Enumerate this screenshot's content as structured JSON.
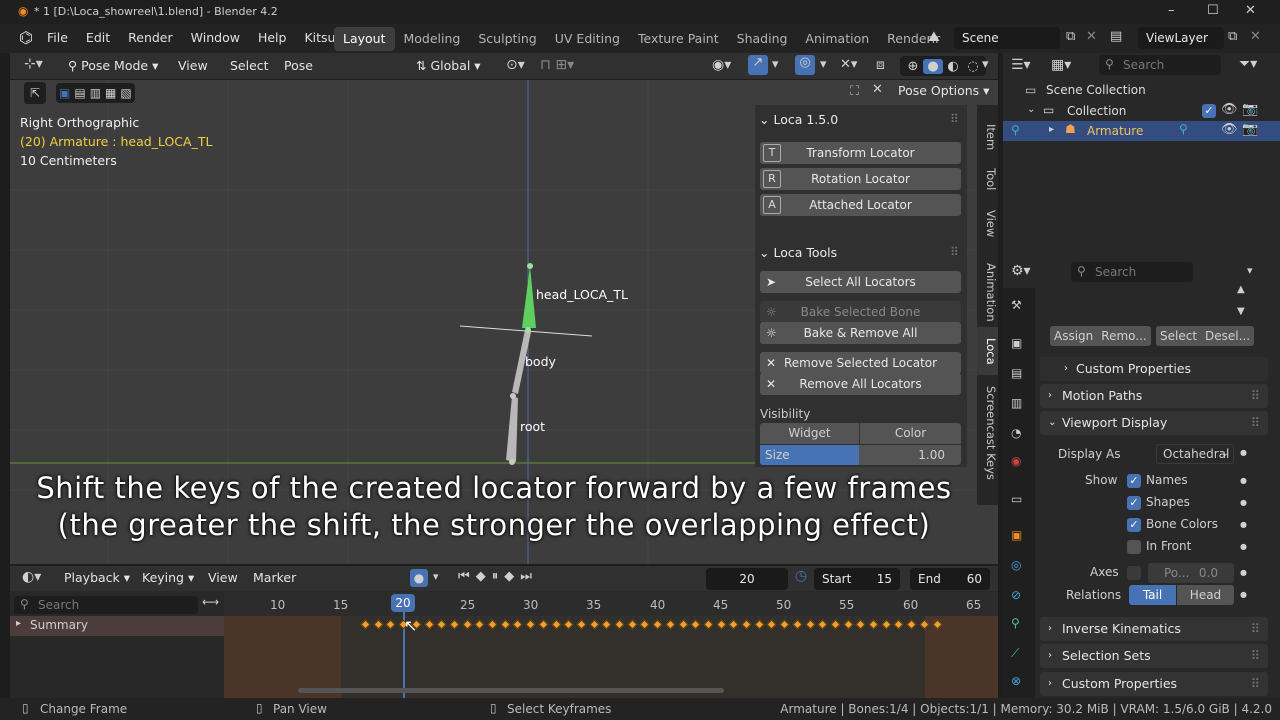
{
  "window": {
    "title": "* 1 [D:\\Loca_showreel\\1.blend] - Blender 4.2",
    "min": "–",
    "max": "☐",
    "close": "✕"
  },
  "menu": [
    "File",
    "Edit",
    "Render",
    "Window",
    "Help",
    "Kitsu"
  ],
  "workspaces": [
    "Layout",
    "Modeling",
    "Sculpting",
    "UV Editing",
    "Texture Paint",
    "Shading",
    "Animation",
    "Renderir"
  ],
  "scene": "Scene",
  "viewlayer": "ViewLayer",
  "viewport": {
    "mode": "Pose Mode",
    "menus": [
      "View",
      "Select",
      "Pose"
    ],
    "orientation": "Global",
    "view_name": "Right Orthographic",
    "object_info": "(20) Armature : head_LOCA_TL",
    "scale": "10 Centimeters",
    "pose_options": "Pose Options",
    "bones": {
      "head": "head_LOCA_TL",
      "body": "body",
      "root": "root"
    }
  },
  "npanel": {
    "loca_header": "Loca 1.5.0",
    "buttons1": [
      {
        "icon": "T",
        "label": "Transform Locator"
      },
      {
        "icon": "R",
        "label": "Rotation Locator"
      },
      {
        "icon": "A",
        "label": "Attached Locator"
      }
    ],
    "tools_header": "Loca Tools",
    "select_all": "Select All Locators",
    "bake_selected": "Bake Selected Bone",
    "bake_remove": "Bake & Remove All",
    "remove_selected": "Remove Selected Locator",
    "remove_all": "Remove All Locators",
    "visibility": "Visibility",
    "widget": "Widget",
    "color": "Color",
    "size_label": "Size",
    "size_value": "1.00",
    "tabs": [
      "Item",
      "Tool",
      "View",
      "Animation",
      "Loca",
      "Screencast Keys"
    ]
  },
  "subtitle": [
    "Shift the keys of the created locator forward by a few frames",
    "(the greater the shift, the stronger the overlapping effect)"
  ],
  "timeline": {
    "menus": [
      "Playback",
      "Keying",
      "View",
      "Marker"
    ],
    "current_frame": "20",
    "start_label": "Start",
    "start": "15",
    "end_label": "End",
    "end": "60",
    "search_placeholder": "Search",
    "summary": "Summary",
    "frame_labels": [
      "10",
      "15",
      "20",
      "25",
      "30",
      "35",
      "40",
      "45",
      "50",
      "55",
      "60",
      "65"
    ],
    "current_label": "20"
  },
  "outliner": {
    "search_placeholder": "Search",
    "scene_collection": "Scene Collection",
    "collection": "Collection",
    "armature": "Armature"
  },
  "properties": {
    "search_placeholder": "Search",
    "assign": "Assign",
    "remove": "Remo...",
    "select": "Select",
    "deselect": "Desel...",
    "custom_props": "Custom Properties",
    "motion_paths": "Motion Paths",
    "viewport_display": "Viewport Display",
    "display_as_label": "Display As",
    "display_as": "Octahedral",
    "show": "Show",
    "names": "Names",
    "shapes": "Shapes",
    "bone_colors": "Bone Colors",
    "in_front": "In Front",
    "axes": "Axes",
    "axes_pos": "Po...",
    "axes_val": "0.0",
    "relations": "Relations",
    "tail": "Tail",
    "head": "Head",
    "inverse_kinematics": "Inverse Kinematics",
    "selection_sets": "Selection Sets",
    "custom_props2": "Custom Properties"
  },
  "status": {
    "change_frame": "Change Frame",
    "pan_view": "Pan View",
    "select_keyframes": "Select Keyframes",
    "info": "Armature | Bones:1/4 | Objects:1/1 | Memory: 30.2 MiB | VRAM: 1.5/6.0 GiB | 4.2.0"
  }
}
